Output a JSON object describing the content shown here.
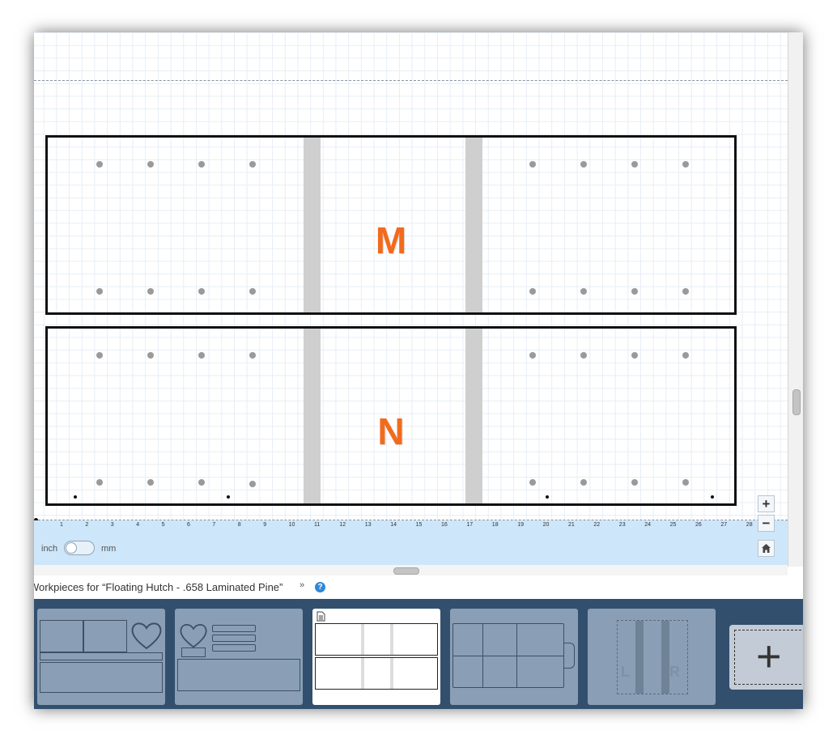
{
  "parts": [
    {
      "label": "M"
    },
    {
      "label": "N"
    }
  ],
  "ruler": {
    "ticks": [
      "1",
      "2",
      "3",
      "4",
      "5",
      "6",
      "7",
      "8",
      "9",
      "10",
      "11",
      "12",
      "13",
      "14",
      "15",
      "16",
      "17",
      "18",
      "19",
      "20",
      "21",
      "22",
      "23",
      "24",
      "25",
      "26",
      "27",
      "28"
    ],
    "unit_left": "inch",
    "unit_right": "mm",
    "unit_selected": "inch"
  },
  "zoom": {
    "zoom_in": "+",
    "zoom_out": "−",
    "home_icon": "home-icon"
  },
  "workpieces": {
    "title": "Workpieces for “Floating Hutch - .658 Laminated Pine”",
    "chevron": "»",
    "help": "?",
    "thumbnail_letters": [
      "L",
      "R"
    ],
    "add_label": "+"
  },
  "colors": {
    "accent": "#f26b1d",
    "tray": "#324f6e",
    "ruler": "#cde6fa"
  }
}
